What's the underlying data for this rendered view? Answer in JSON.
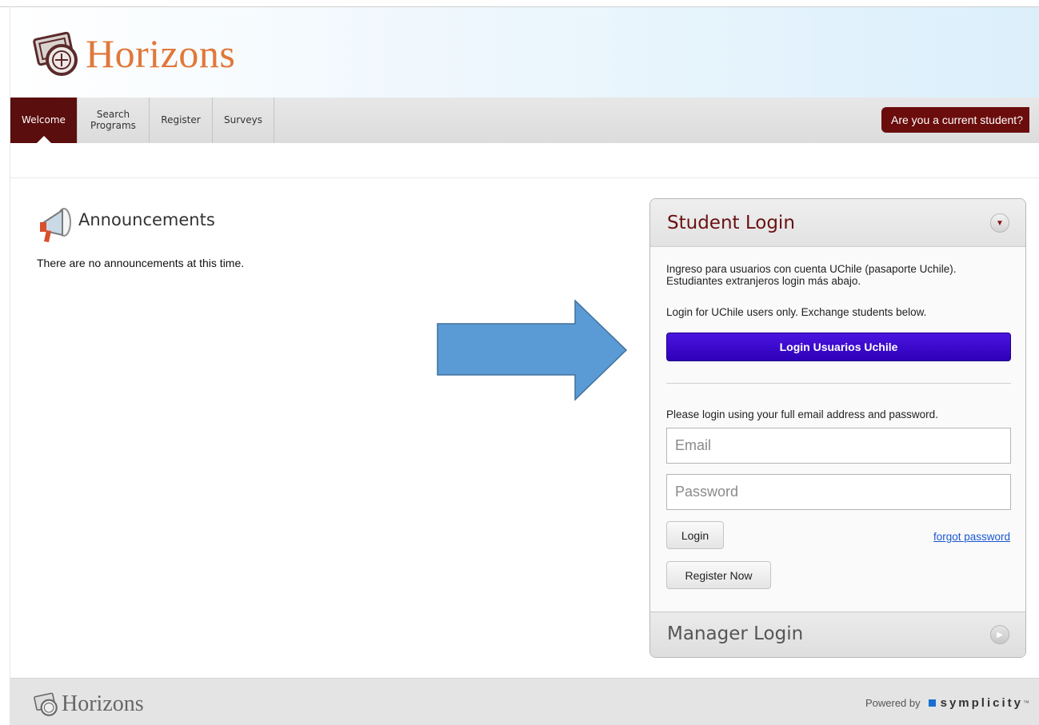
{
  "header": {
    "brand": "Horizons",
    "logo_icon": "passport-stamp-icon"
  },
  "nav": {
    "tabs": [
      {
        "label": "Welcome",
        "active": true
      },
      {
        "label": "Search Programs",
        "active": false
      },
      {
        "label": "Register",
        "active": false
      },
      {
        "label": "Surveys",
        "active": false
      }
    ],
    "current_student_label": "Are you a current student?"
  },
  "announcements": {
    "title": "Announcements",
    "icon": "megaphone-icon",
    "empty_text": "There are no announcements at this time."
  },
  "student_login": {
    "title": "Student Login",
    "intro_es": "Ingreso para usuarios con cuenta UChile (pasaporte Uchile). Estudiantes extranjeros login más abajo.",
    "intro_en": "Login for UChile users only. Exchange students below.",
    "uchile_button": "Login Usuarios Uchile",
    "instructions": "Please login using your full email address and password.",
    "email_placeholder": "Email",
    "password_placeholder": "Password",
    "login_button": "Login",
    "forgot_link": "forgot password",
    "register_button": "Register Now"
  },
  "manager_login": {
    "title": "Manager Login"
  },
  "footer": {
    "brand": "Horizons",
    "powered_by": "Powered by",
    "vendor": "symplicity",
    "trademark": "™"
  },
  "colors": {
    "brand_orange": "#e0783a",
    "nav_active": "#5b0e0e",
    "student_button": "#6b0d0d",
    "uchile_button": "#3a0ad0",
    "annotation_arrow": "#5b9bd5"
  }
}
